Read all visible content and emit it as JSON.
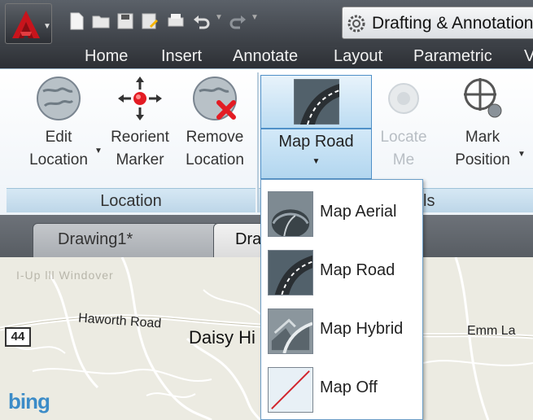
{
  "quick_access": {
    "workspace_label": "Drafting & Annotation",
    "icons": [
      "new-icon",
      "open-icon",
      "save-icon",
      "save-as-icon",
      "plot-icon",
      "undo-icon",
      "redo-icon"
    ]
  },
  "ribbon_tabs": [
    "Home",
    "Insert",
    "Annotate",
    "Layout",
    "Parametric",
    "V"
  ],
  "location_panel": {
    "title": "Location",
    "edit_location": [
      "Edit",
      "Location"
    ],
    "reorient_marker": [
      "Reorient",
      "Marker"
    ],
    "remove_location": [
      "Remove",
      "Location"
    ]
  },
  "tools_panel": {
    "title_fragment": "ls",
    "map_road": "Map Road",
    "locate_me": [
      "Locate",
      "Me"
    ],
    "mark_position": [
      "Mark",
      "Position"
    ]
  },
  "drawing_tabs": [
    "Drawing1*",
    "Dra"
  ],
  "map": {
    "faded_label": "I-Up lll Windover",
    "road_haworth": "Haworth Road",
    "town_daisy": "Daisy Hi",
    "road_emm": "Emm La",
    "route_shield": "44",
    "bing_logo": "bing"
  },
  "map_dropdown": [
    {
      "label": "Map Aerial",
      "icon": "map-aerial-icon"
    },
    {
      "label": "Map Road",
      "icon": "map-road-icon"
    },
    {
      "label": "Map Hybrid",
      "icon": "map-hybrid-icon"
    },
    {
      "label": "Map Off",
      "icon": "map-off-icon"
    }
  ],
  "colors": {
    "ribbon_accent": "#4f90c8",
    "app_red": "#c8141c",
    "bing_blue": "#3c8cc8"
  }
}
